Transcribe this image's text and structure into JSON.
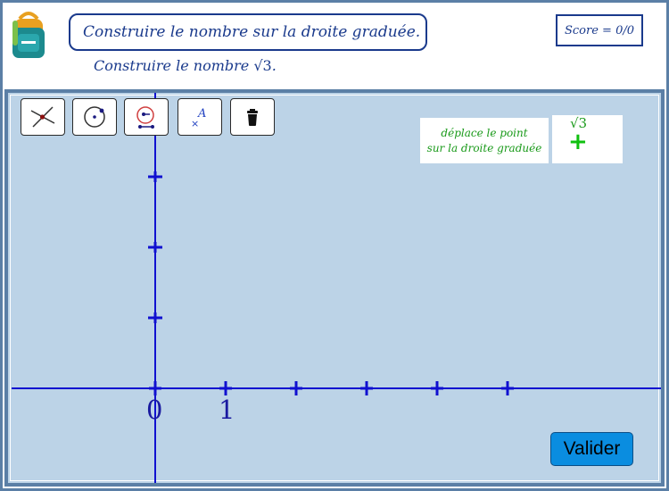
{
  "header": {
    "title": "Construire le nombre sur la droite graduée.",
    "instruction_prefix": "Construire le nombre ",
    "instruction_number": "√3",
    "instruction_suffix": ".",
    "score": "Score = 0/0",
    "logo_icon": "backpack-icon"
  },
  "toolbar": {
    "tools": [
      {
        "name": "intersection-tool",
        "icon": "intersection-icon"
      },
      {
        "name": "circle-tool",
        "icon": "circle-center-point-icon"
      },
      {
        "name": "compass-tool",
        "icon": "compass-icon"
      },
      {
        "name": "point-tool",
        "icon": "point-label-icon",
        "glyph": "A"
      },
      {
        "name": "delete-tool",
        "icon": "trash-icon"
      }
    ]
  },
  "hint": {
    "line1": "déplace le point",
    "line2": "sur la droite graduée"
  },
  "draggable_point": {
    "label": "√3",
    "symbol": "+"
  },
  "graph": {
    "axis_color": "#1010d0",
    "x_tick_labels": [
      "0",
      "1"
    ],
    "x_ticks_count": 6,
    "y_ticks_count": 3
  },
  "actions": {
    "validate_label": "Valider"
  },
  "colors": {
    "accent": "#1a3a8c",
    "panel_bg": "#bcd3e7",
    "hint_text": "#1a9a1a",
    "point": "#10c010",
    "button": "#0a8de0"
  }
}
